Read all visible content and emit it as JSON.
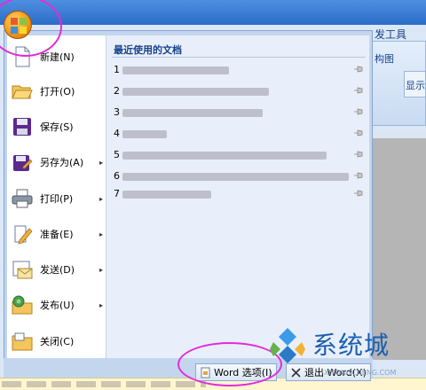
{
  "ribbon": {
    "tab_label": "发工具",
    "group_label_1": "构图",
    "group_label_2": "显示"
  },
  "office_menu": {
    "items": [
      {
        "label": "新建(N)",
        "icon": "new-document-icon",
        "has_submenu": false
      },
      {
        "label": "打开(O)",
        "icon": "open-folder-icon",
        "has_submenu": false
      },
      {
        "label": "保存(S)",
        "icon": "save-disk-icon",
        "has_submenu": false
      },
      {
        "label": "另存为(A)",
        "icon": "save-as-icon",
        "has_submenu": true
      },
      {
        "label": "打印(P)",
        "icon": "printer-icon",
        "has_submenu": true
      },
      {
        "label": "准备(E)",
        "icon": "prepare-pencil-icon",
        "has_submenu": true
      },
      {
        "label": "发送(D)",
        "icon": "send-mail-icon",
        "has_submenu": true
      },
      {
        "label": "发布(U)",
        "icon": "publish-icon",
        "has_submenu": true
      },
      {
        "label": "关闭(C)",
        "icon": "close-folder-icon",
        "has_submenu": false
      }
    ],
    "submenu_arrow": "▸",
    "recent": {
      "title": "最近使用的文档",
      "entries": [
        {
          "num": "1"
        },
        {
          "num": "2"
        },
        {
          "num": "3"
        },
        {
          "num": "4"
        },
        {
          "num": "5"
        },
        {
          "num": "6"
        },
        {
          "num": "7"
        }
      ]
    },
    "footer": {
      "options_label": "Word 选项(I)",
      "exit_label": "退出 Word(X)"
    }
  },
  "watermark": {
    "brand": "系统城",
    "sub": "XITONGCHENG.COM"
  },
  "colors": {
    "menu_bg": "#c4d6ee",
    "recent_bg": "#e9effa",
    "annotation_ring": "#e32bdb",
    "watermark_blue": "#1a5fb0"
  }
}
